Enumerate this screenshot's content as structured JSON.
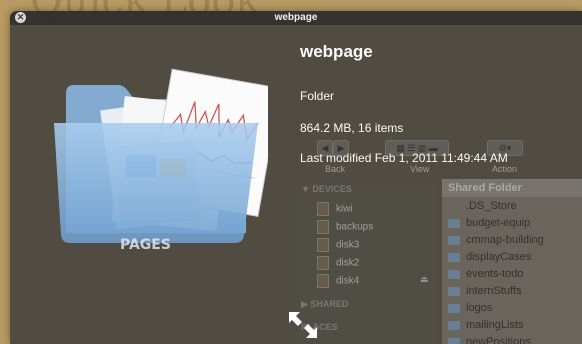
{
  "background_title": "Quick Look",
  "window": {
    "title": "webpage"
  },
  "info": {
    "name": "webpage",
    "kind": "Folder",
    "size": "864.2 MB, 16 items",
    "modified": "Last modified Feb 1, 2011 11:49:44 AM"
  },
  "folder_icon": {
    "badge_text": "PAGES"
  },
  "finder": {
    "toolbar": {
      "back": "Back",
      "view": "View",
      "action": "Action"
    },
    "sidebar": {
      "devices_header": "▼ DEVICES",
      "devices": [
        "kiwi",
        "backups",
        "disk3",
        "disk2",
        "disk4"
      ],
      "shared_header": "▶ SHARED",
      "places_header": "PLACES"
    },
    "list": {
      "header": "Shared Folder",
      "items": [
        ".DS_Store",
        "budget-equip",
        "cmmap-building",
        "displayCases",
        "events-todo",
        "internStuffs",
        "logos",
        "mailingLists",
        "newPositions"
      ]
    }
  },
  "colors": {
    "panel": "#3a3a3a",
    "folder_blue": "#7fb0e0",
    "desk": "#b99a62"
  }
}
